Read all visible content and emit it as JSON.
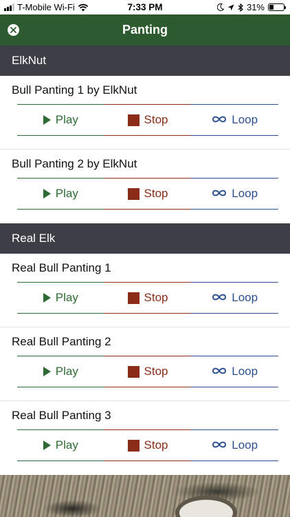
{
  "status_bar": {
    "carrier": "T-Mobile Wi-Fi",
    "time": "7:33 PM",
    "battery_percent": "31%",
    "battery_level": 0.31
  },
  "nav": {
    "title": "Panting"
  },
  "sections": [
    {
      "title": "ElkNut",
      "sounds": [
        {
          "title": "Bull Panting 1 by ElkNut",
          "play": "Play",
          "stop": "Stop",
          "loop": "Loop"
        },
        {
          "title": "Bull Panting 2 by ElkNut",
          "play": "Play",
          "stop": "Stop",
          "loop": "Loop"
        }
      ]
    },
    {
      "title": "Real Elk",
      "sounds": [
        {
          "title": "Real Bull Panting 1",
          "play": "Play",
          "stop": "Stop",
          "loop": "Loop"
        },
        {
          "title": "Real Bull Panting 2",
          "play": "Play",
          "stop": "Stop",
          "loop": "Loop"
        },
        {
          "title": "Real Bull Panting 3",
          "play": "Play",
          "stop": "Stop",
          "loop": "Loop"
        }
      ]
    }
  ],
  "colors": {
    "nav_green": "#2d5b2f",
    "section_header": "#3e3e46",
    "play_green": "#2e6b34",
    "stop_red": "#8a2c18",
    "loop_blue": "#2c4f8f"
  },
  "icons": {
    "close": "close-circle-icon",
    "play": "play-triangle-icon",
    "stop": "stop-square-icon",
    "loop": "infinity-icon"
  }
}
